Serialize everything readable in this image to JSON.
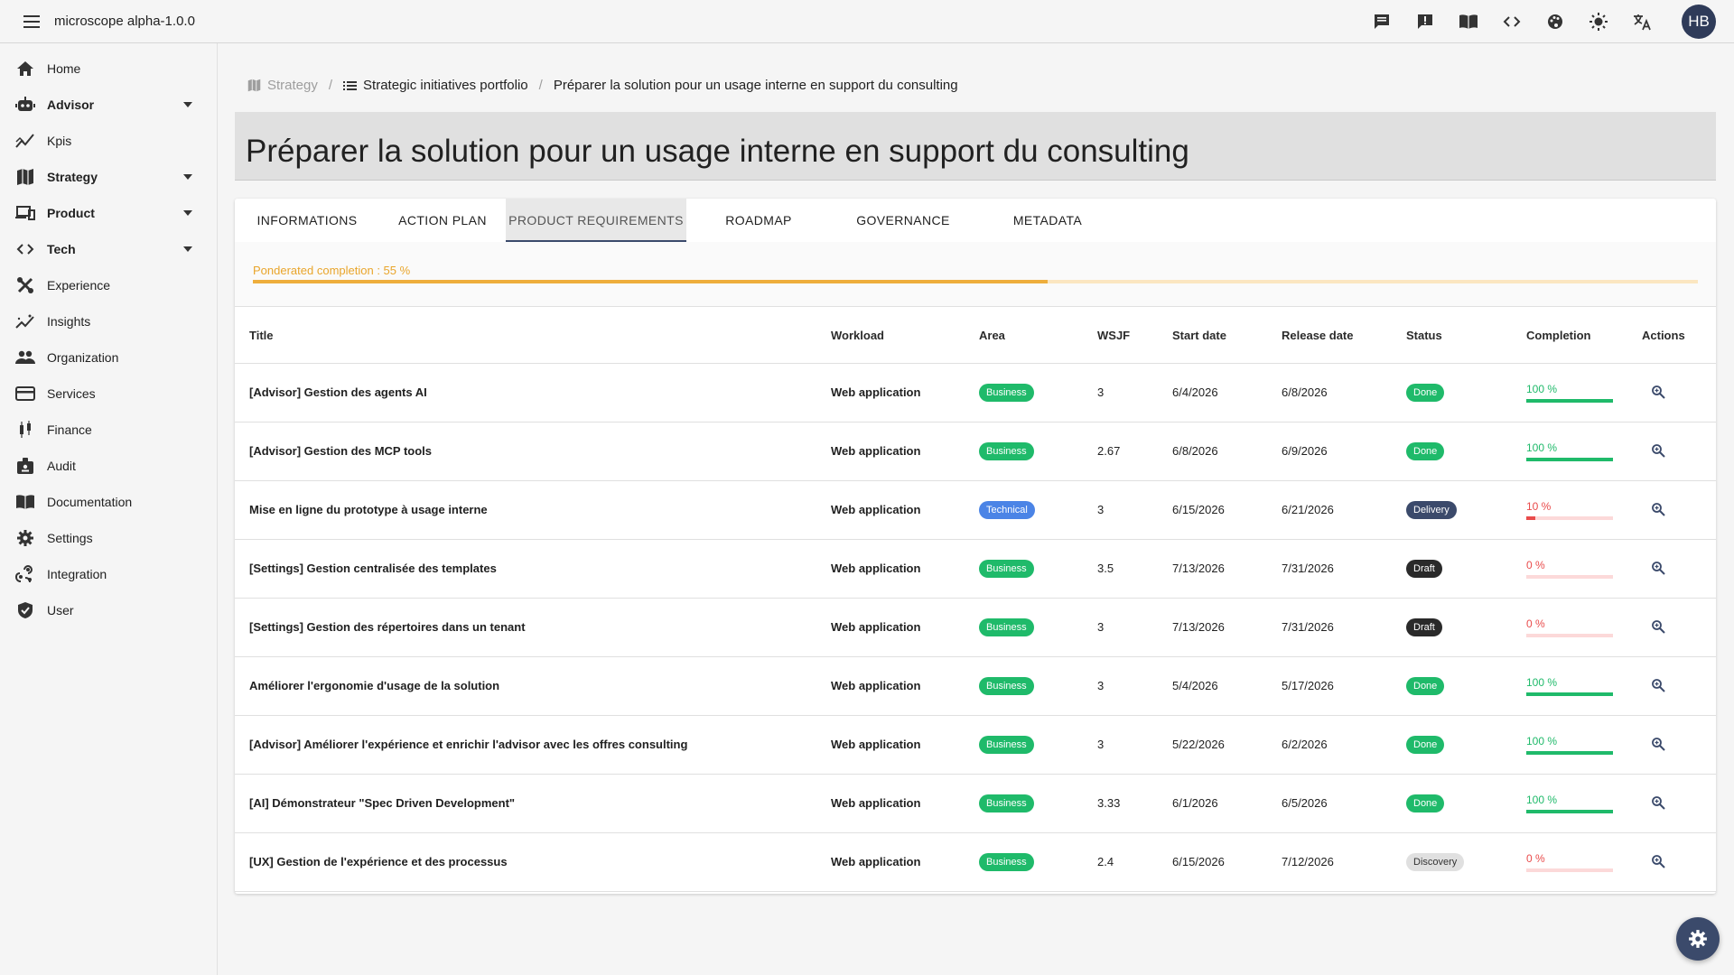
{
  "app": {
    "title": "microscope  alpha-1.0.0",
    "user_initials": "HB"
  },
  "sidebar": {
    "items": [
      {
        "label": "Home",
        "icon": "home-icon"
      },
      {
        "label": "Advisor",
        "icon": "robot-icon"
      },
      {
        "label": "Kpis",
        "icon": "chart-line-icon"
      },
      {
        "label": "Strategy",
        "icon": "map-icon"
      },
      {
        "label": "Product",
        "icon": "devices-icon"
      },
      {
        "label": "Tech",
        "icon": "code-icon"
      },
      {
        "label": "Experience",
        "icon": "design-icon"
      },
      {
        "label": "Insights",
        "icon": "insights-icon"
      },
      {
        "label": "Organization",
        "icon": "people-icon"
      },
      {
        "label": "Services",
        "icon": "card-icon"
      },
      {
        "label": "Finance",
        "icon": "candlestick-icon"
      },
      {
        "label": "Audit",
        "icon": "badge-icon"
      },
      {
        "label": "Documentation",
        "icon": "book-icon"
      },
      {
        "label": "Settings",
        "icon": "gear-icon"
      },
      {
        "label": "Integration",
        "icon": "integration-icon"
      },
      {
        "label": "User",
        "icon": "shield-icon"
      }
    ]
  },
  "breadcrumb": {
    "items": [
      {
        "label": "Strategy"
      },
      {
        "label": "Strategic initiatives portfolio"
      },
      {
        "label": "Préparer la solution pour un usage interne en support du consulting"
      }
    ]
  },
  "page": {
    "title": "Préparer la solution pour un usage interne en support du consulting"
  },
  "tabs": [
    {
      "label": "INFORMATIONS"
    },
    {
      "label": "ACTION PLAN"
    },
    {
      "label": "PRODUCT REQUIREMENTS"
    },
    {
      "label": "ROADMAP"
    },
    {
      "label": "GOVERNANCE"
    },
    {
      "label": "METADATA"
    }
  ],
  "progress": {
    "label": "Ponderated completion : 55 %",
    "value": 55
  },
  "table": {
    "headers": [
      "Title",
      "Workload",
      "Area",
      "WSJF",
      "Start date",
      "Release date",
      "Status",
      "Completion",
      "Actions"
    ],
    "rows": [
      {
        "title": "[Advisor] Gestion des agents AI",
        "workload": "Web application",
        "area": "Business",
        "wsjf": "3",
        "start": "6/4/2026",
        "release": "6/8/2026",
        "status": "Done",
        "completion": "100 %",
        "completion_value": 100
      },
      {
        "title": "[Advisor] Gestion des MCP tools",
        "workload": "Web application",
        "area": "Business",
        "wsjf": "2.67",
        "start": "6/8/2026",
        "release": "6/9/2026",
        "status": "Done",
        "completion": "100 %",
        "completion_value": 100
      },
      {
        "title": "Mise en ligne du prototype à usage interne",
        "workload": "Web application",
        "area": "Technical",
        "wsjf": "3",
        "start": "6/15/2026",
        "release": "6/21/2026",
        "status": "Delivery",
        "completion": "10 %",
        "completion_value": 10
      },
      {
        "title": "[Settings] Gestion centralisée des templates",
        "workload": "Web application",
        "area": "Business",
        "wsjf": "3.5",
        "start": "7/13/2026",
        "release": "7/31/2026",
        "status": "Draft",
        "completion": "0 %",
        "completion_value": 0
      },
      {
        "title": "[Settings] Gestion des répertoires dans un tenant",
        "workload": "Web application",
        "area": "Business",
        "wsjf": "3",
        "start": "7/13/2026",
        "release": "7/31/2026",
        "status": "Draft",
        "completion": "0 %",
        "completion_value": 0
      },
      {
        "title": "Améliorer l'ergonomie d'usage de la solution",
        "workload": "Web application",
        "area": "Business",
        "wsjf": "3",
        "start": "5/4/2026",
        "release": "5/17/2026",
        "status": "Done",
        "completion": "100 %",
        "completion_value": 100
      },
      {
        "title": "[Advisor] Améliorer l'expérience et enrichir l'advisor avec les offres consulting",
        "workload": "Web application",
        "area": "Business",
        "wsjf": "3",
        "start": "5/22/2026",
        "release": "6/2/2026",
        "status": "Done",
        "completion": "100 %",
        "completion_value": 100
      },
      {
        "title": "[AI] Démonstrateur \"Spec Driven Development\"",
        "workload": "Web application",
        "area": "Business",
        "wsjf": "3.33",
        "start": "6/1/2026",
        "release": "6/5/2026",
        "status": "Done",
        "completion": "100 %",
        "completion_value": 100
      },
      {
        "title": "[UX] Gestion de l'expérience et des processus",
        "workload": "Web application",
        "area": "Business",
        "wsjf": "2.4",
        "start": "6/15/2026",
        "release": "7/12/2026",
        "status": "Discovery",
        "completion": "0 %",
        "completion_value": 0
      }
    ]
  },
  "colors": {
    "primary": "#3b4a6b",
    "success": "#1fba6a",
    "danger": "#e94b4b",
    "warning": "#eeae3c",
    "info": "#4b84e6"
  }
}
